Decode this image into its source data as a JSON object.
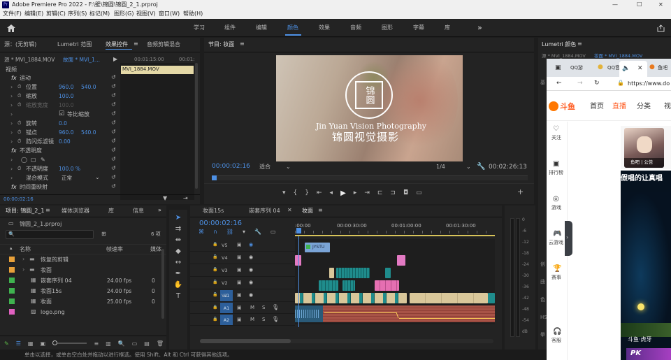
{
  "titlebar": {
    "title": "Adobe Premiere Pro 2022 - F:\\壁\\锦圆\\锦圆_2_1.prproj",
    "minimize": "—",
    "maximize": "□",
    "close": "✕"
  },
  "menubar": [
    "文件(F)",
    "编辑(E)",
    "剪辑(C)",
    "序列(S)",
    "标记(M)",
    "图形(G)",
    "视图(V)",
    "窗口(W)",
    "帮助(H)"
  ],
  "workspaces": [
    "学习",
    "组件",
    "编辑",
    "颜色",
    "效果",
    "音频",
    "图形",
    "字幕",
    "库"
  ],
  "workspace_active": "颜色",
  "more": "»",
  "source_panel": {
    "tabs": [
      "源：(无剪辑)",
      "Lumetri 范围",
      "效果控件",
      "音频剪辑混合"
    ],
    "clip_name": "源 * MVI_1884.MOV",
    "clip_link": "故面 * MVI_1...",
    "ruler": [
      "00:01:15:00",
      "00:01:"
    ],
    "video_label": "视频",
    "clip_chip": "MVI_1884.MOV",
    "timecode": "00:00:02:16",
    "fx_rows": [
      {
        "indent": 0,
        "fx": "fx",
        "label": "运动"
      },
      {
        "indent": 1,
        "label": "位置",
        "v1": "960.0",
        "v2": "540.0"
      },
      {
        "indent": 1,
        "label": "缩放",
        "v1": "100.0"
      },
      {
        "indent": 1,
        "label": "缩放宽度",
        "v1": "100.0",
        "dim": true
      },
      {
        "indent": 1,
        "label": "等比缩放",
        "check": true
      },
      {
        "indent": 1,
        "label": "旋转",
        "v1": "0.0"
      },
      {
        "indent": 1,
        "label": "锚点",
        "v1": "960.0",
        "v2": "540.0"
      },
      {
        "indent": 1,
        "label": "防闪烁滤镜",
        "v1": "0.00"
      },
      {
        "indent": 0,
        "fx": "fx",
        "label": "不透明度"
      },
      {
        "indent": 1,
        "label": "",
        "shapes": true
      },
      {
        "indent": 1,
        "label": "不透明度",
        "v1": "100.0 %"
      },
      {
        "indent": 1,
        "label": "混合模式",
        "v1": "正常",
        "select": true
      },
      {
        "indent": 0,
        "fx": "fx",
        "label": "时间重映射"
      }
    ]
  },
  "program": {
    "title": "节目: 妆面",
    "menu": "≡",
    "overlay": {
      "line1": "Jin Yuan Vision Photography",
      "line2": "锦圆视觉摄影",
      "seal": "锦圆"
    },
    "timecode_left": "00:00:02:16",
    "fit": "适合",
    "fraction": "1/4",
    "timecode_right": "00:02:26:13"
  },
  "lumetri": {
    "title": "Lumetri 颜色",
    "menu": "≡",
    "sub1": "源 * MVI_1884.MOV",
    "sub2": "妆面 * MVI_1884.MOV",
    "labels": [
      "基",
      "创",
      "曲",
      "色",
      "HS",
      "晕"
    ]
  },
  "browser": {
    "tabs": [
      "QQ游",
      "QQ音",
      "鱼吧"
    ],
    "url": "https://www.do",
    "nav": [
      "首页",
      "直播",
      "分类",
      "视"
    ],
    "sidebar": [
      "关注",
      "排行榜",
      "游戏",
      "云游戏",
      "赛事",
      "客服"
    ],
    "live_title": "假唱的让真唱",
    "avatar_badge": "鱼吧 | 公告",
    "banner": "斗鱼·虎牙"
  },
  "project": {
    "tabs": [
      "项目: 锦圆_2_1",
      "媒体浏览器",
      "库",
      "信息"
    ],
    "file": "锦圆_2_1.prproj",
    "count": "6 项",
    "headers": [
      "名称",
      "帧速率",
      "媒体"
    ],
    "items": [
      {
        "color": "#e8a13a",
        "folder": true,
        "name": "恢复的剪辑",
        "fps": ""
      },
      {
        "color": "#e8a13a",
        "folder": true,
        "name": "妆面",
        "fps": ""
      },
      {
        "color": "#3fb34f",
        "name": "嵌套序列 04",
        "fps": "24.00 fps",
        "extra": "0"
      },
      {
        "color": "#3fb34f",
        "name": "妆面15s",
        "fps": "24.00 fps",
        "extra": "0"
      },
      {
        "color": "#3fb34f",
        "name": "妆面",
        "fps": "25.00 fps",
        "extra": "0"
      }
    ],
    "logo": {
      "color": "#e060c0",
      "name": "logo.png"
    }
  },
  "timeline": {
    "tabs": [
      "妆面15s",
      "嵌套序列 04",
      "妆面"
    ],
    "active": "妆面",
    "timecode": "00:00:02:16",
    "ruler": [
      ":00:00",
      "00:00:30:00",
      "00:01:00:00",
      "00:01:30:00"
    ],
    "tracks": [
      {
        "name": "V5",
        "kind": "v"
      },
      {
        "name": "V4",
        "kind": "v"
      },
      {
        "name": "V3",
        "kind": "v"
      },
      {
        "name": "V2",
        "kind": "v"
      },
      {
        "name": "V1",
        "kind": "v",
        "target": "V1"
      },
      {
        "name": "A1",
        "kind": "a",
        "target": "A1"
      },
      {
        "name": "A2",
        "kind": "a",
        "target": "A2"
      }
    ],
    "title_clip": "JYSTU",
    "m": "M",
    "s": "S"
  },
  "meter_labels": [
    "0",
    "-6",
    "-12",
    "-18",
    "-24",
    "-30",
    "-36",
    "-42",
    "-48",
    "-54",
    "dB"
  ],
  "status": "单击以选择，或单击空白处并拖动以进行框选。使用 Shift、Alt 和 Ctrl 可获得其他选项。"
}
